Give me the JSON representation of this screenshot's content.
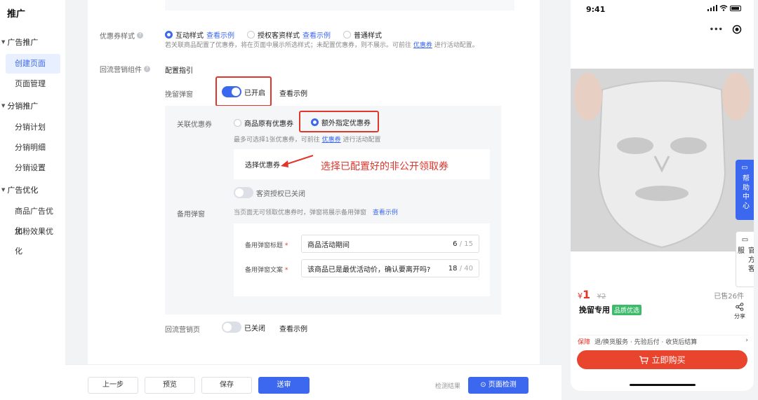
{
  "sidebar": {
    "title": "推广",
    "groups": [
      {
        "label": "广告推广",
        "items": [
          {
            "label": "创建页面",
            "active": true
          },
          {
            "label": "页面管理"
          }
        ]
      },
      {
        "label": "分销推广",
        "items": [
          {
            "label": "分销计划"
          },
          {
            "label": "分销明细"
          },
          {
            "label": "分销设置"
          }
        ]
      },
      {
        "label": "广告优化",
        "items": [
          {
            "label": "商品广告优化"
          },
          {
            "label": "加粉效果优化"
          }
        ]
      }
    ]
  },
  "form": {
    "coupon_style": {
      "label": "优惠券样式",
      "options": [
        {
          "label": "互动样式",
          "link": "查看示例",
          "selected": true
        },
        {
          "label": "授权客资样式",
          "link": "查看示例",
          "selected": false
        },
        {
          "label": "普通样式",
          "selected": false
        }
      ],
      "hint_pre": "若关联商品配置了优惠券，将在页面中展示所选样式；未配置优惠券，则不展示。可前往",
      "hint_link": "优惠券",
      "hint_post": "进行活动配置。"
    },
    "return_component": {
      "label": "回流营销组件",
      "guide_link": "配置指引"
    },
    "retain_popup": {
      "label": "挽留弹窗",
      "toggle_on": true,
      "toggle_text": "已开启",
      "example_link": "查看示例"
    },
    "linked_coupon": {
      "label": "关联优惠券",
      "options": [
        {
          "label": "商品原有优惠券",
          "selected": false
        },
        {
          "label": "额外指定优惠券",
          "selected": true
        }
      ],
      "hint_pre": "最多可选择1张优惠券，可前往",
      "hint_link": "优惠券",
      "hint_post": "进行活动配置",
      "select_link": "选择优惠券",
      "annotation": "选择已配置好的非公开领取券"
    },
    "customer_auth": {
      "toggle_on": false,
      "text": "客资授权已关闭"
    },
    "backup_popup": {
      "label": "备用弹窗",
      "hint": "当页面无可领取优惠券时，弹窗将展示备用弹窗",
      "example_link": "查看示例",
      "title_label": "备用弹窗标题",
      "title_value": "商品活动期间",
      "title_count": "6",
      "title_max": "/ 15",
      "text_label": "备用弹窗文案",
      "text_value": "该商品已是最优活动价，确认要离开吗?",
      "text_count": "18",
      "text_max": "/ 40",
      "required_mark": "*"
    },
    "return_page": {
      "label": "回流营销页",
      "toggle_on": false,
      "toggle_text": "已关闭",
      "example_link": "查看示例"
    }
  },
  "footer": {
    "prev": "上一步",
    "preview": "预览",
    "save": "保存",
    "submit": "送审",
    "check_result": "检测结果",
    "page_check": "页面检测"
  },
  "phone": {
    "time": "9:41",
    "menu_dots": "•••",
    "help_center": "帮助中心",
    "official_cs": "官方客服",
    "price_symbol": "¥",
    "price": "1",
    "original_price": "¥2",
    "sold": "已售26件",
    "product_name": "挽留专用",
    "badge": "品质优选",
    "share": "分享",
    "guarantee_label": "保障",
    "guarantee_text": "退/换货服务 · 先验后付 · 收货后结算",
    "chevron": "›",
    "buy_button": "立即购买"
  },
  "colors": {
    "accent": "#3c68f0",
    "highlight_red": "#e0362b",
    "buy_red": "#e8442e",
    "badge_green": "#3dbb6a"
  }
}
